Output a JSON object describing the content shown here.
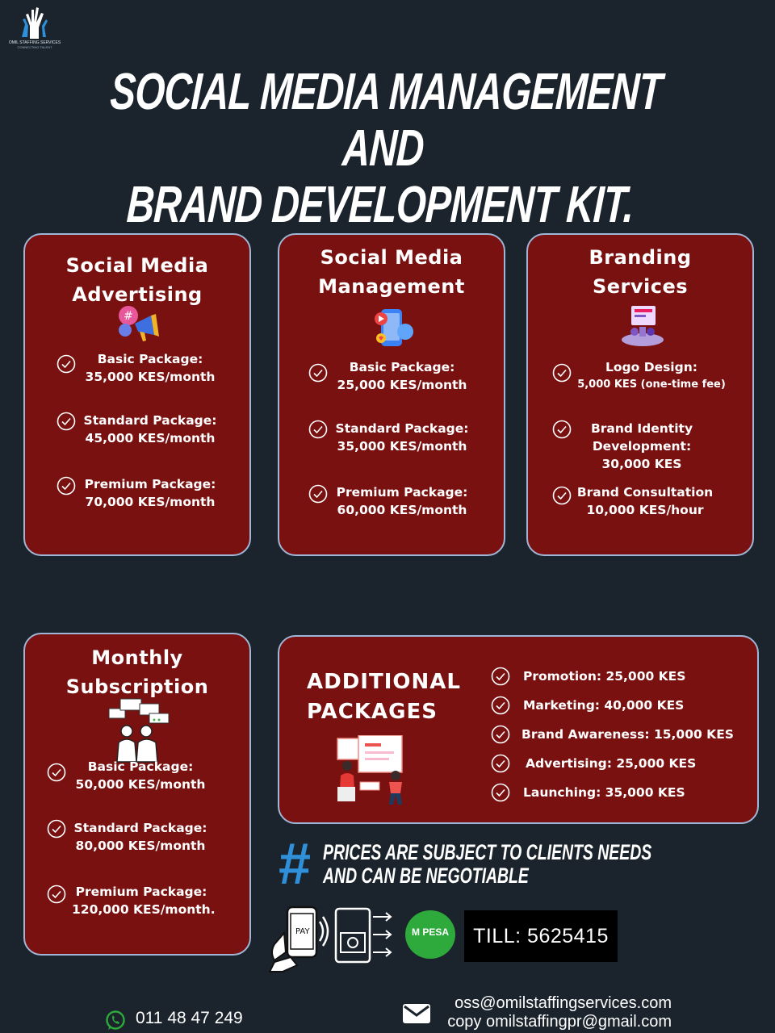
{
  "brand": {
    "logo_name": "OMIL STAFFING SERVICES",
    "logo_tagline": "CONNECTING TALENT"
  },
  "title": {
    "line1": "SOCIAL MEDIA MANAGEMENT AND",
    "line2": "BRAND DEVELOPMENT KIT."
  },
  "cards": {
    "advertising": {
      "title": [
        "Social Media",
        "Advertising"
      ],
      "items": [
        [
          "Basic Package:",
          "35,000 KES/month"
        ],
        [
          "Standard Package:",
          "45,000 KES/month"
        ],
        [
          "Premium Package:",
          "70,000 KES/month"
        ]
      ]
    },
    "management": {
      "title": [
        "Social Media",
        "Management"
      ],
      "items": [
        [
          "Basic Package:",
          "25,000 KES/month"
        ],
        [
          "Standard Package:",
          "35,000 KES/month"
        ],
        [
          "Premium Package:",
          "60,000 KES/month"
        ]
      ]
    },
    "branding": {
      "title": [
        "Branding",
        "Services"
      ],
      "items": [
        [
          "Logo Design:",
          "5,000 KES (one-time fee)"
        ],
        [
          "Brand Identity",
          "Development:",
          "30,000 KES"
        ],
        [
          "Brand Consultation",
          "10,000 KES/hour"
        ]
      ]
    },
    "subscription": {
      "title": [
        "Monthly",
        "Subscription"
      ],
      "items": [
        [
          "Basic Package:",
          "50,000 KES/month"
        ],
        [
          "Standard Package:",
          "80,000 KES/month"
        ],
        [
          "Premium Package:",
          "120,000 KES/month."
        ]
      ]
    }
  },
  "additional": {
    "title": [
      "ADDITIONAL",
      "PACKAGES"
    ],
    "items": [
      "Promotion: 25,000 KES",
      "Marketing: 40,000 KES",
      "Brand Awareness: 15,000 KES",
      "Advertising: 25,000 KES",
      "Launching: 35,000 KES"
    ]
  },
  "note": {
    "hash": "#",
    "line1": "PRICES ARE SUBJECT TO CLIENTS NEEDS",
    "line2": "AND CAN BE NEGOTIABLE"
  },
  "payment": {
    "pay_label": "PAY",
    "mpesa": "M PESA",
    "till": "TILL: 5625415"
  },
  "contact": {
    "phone": "011 48 47 249",
    "email1": "oss@omilstaffingservices.com",
    "email2": "copy omilstaffingpr@gmail.com"
  },
  "colors": {
    "background": "#1b242c",
    "card": "#7a1111",
    "card_border": "#9fb6d6",
    "accent_blue": "#2f8fd8",
    "mpesa_green": "#2eaa3c"
  },
  "icons": [
    "check-circle-icon",
    "megaphone-hashtag-icon",
    "social-phone-icon",
    "branding-stand-icon",
    "chat-people-icon",
    "presentation-icon",
    "hand-phone-pay-icon",
    "wallet-transfer-icon",
    "whatsapp-icon",
    "email-icon"
  ]
}
